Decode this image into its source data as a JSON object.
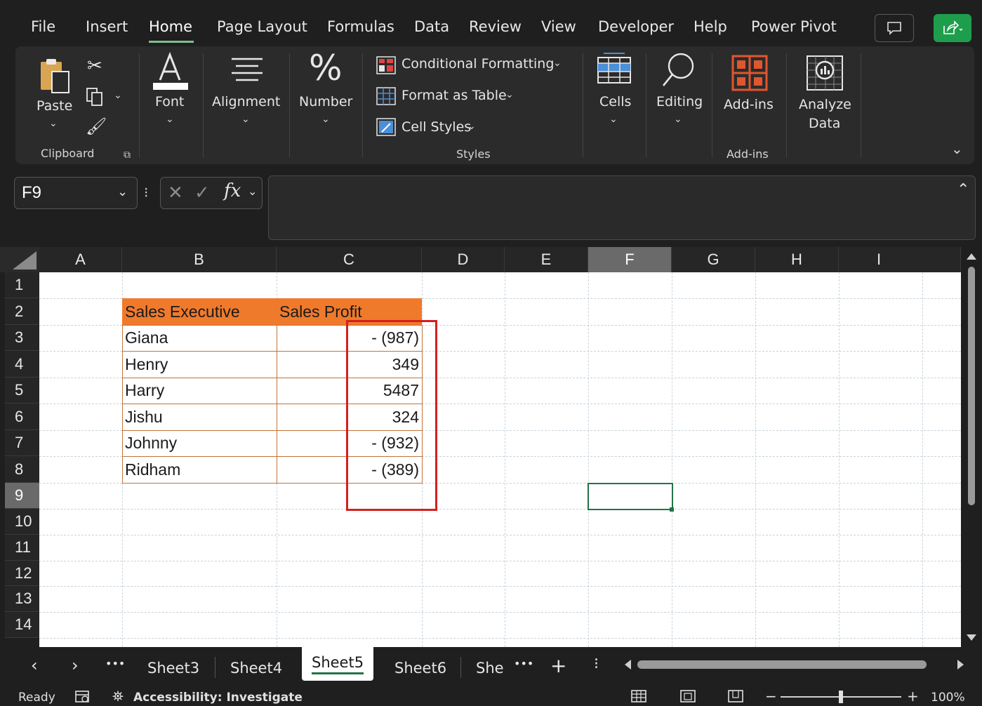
{
  "menu": {
    "items": [
      "File",
      "Insert",
      "Home",
      "Page Layout",
      "Formulas",
      "Data",
      "Review",
      "View",
      "Developer",
      "Help",
      "Power Pivot"
    ],
    "active": "Home"
  },
  "ribbon": {
    "paste": "Paste",
    "clipboard": "Clipboard",
    "font": "Font",
    "alignment": "Alignment",
    "number": "Number",
    "conditional_formatting": "Conditional Formatting",
    "format_as_table": "Format as Table",
    "cell_styles": "Cell Styles",
    "styles": "Styles",
    "cells": "Cells",
    "editing": "Editing",
    "addins": "Add-ins",
    "analyze_data_1": "Analyze",
    "analyze_data_2": "Data",
    "addins_group": "Add-ins"
  },
  "formula_bar": {
    "name_box": "F9",
    "fx": "fx",
    "content": ""
  },
  "columns": [
    "A",
    "B",
    "C",
    "D",
    "E",
    "F",
    "G",
    "H",
    "I"
  ],
  "selected_column": "F",
  "rows": [
    "1",
    "2",
    "3",
    "4",
    "5",
    "6",
    "7",
    "8",
    "9",
    "10",
    "11",
    "12",
    "13",
    "14"
  ],
  "selected_row": "9",
  "table": {
    "header_b": "Sales Executive",
    "header_c": "Sales Profit",
    "rows": [
      {
        "name": "Giana",
        "profit": "- (987)"
      },
      {
        "name": "Henry",
        "profit": "349"
      },
      {
        "name": "Harry",
        "profit": "5487"
      },
      {
        "name": "Jishu",
        "profit": "324"
      },
      {
        "name": "Johnny",
        "profit": "- (932)"
      },
      {
        "name": "Ridham",
        "profit": "- (389)"
      }
    ]
  },
  "sheet_tabs": {
    "tabs": [
      "Sheet3",
      "Sheet4",
      "Sheet5",
      "Sheet6",
      "She"
    ],
    "active": "Sheet5",
    "more": "•••",
    "add": "+"
  },
  "status": {
    "ready": "Ready",
    "accessibility": "Accessibility: Investigate",
    "zoom": "100%",
    "zoom_level": 0.5
  },
  "colors": {
    "accent_green": "#217346",
    "header_orange": "#f07a2c",
    "highlight_red": "#d42020"
  }
}
